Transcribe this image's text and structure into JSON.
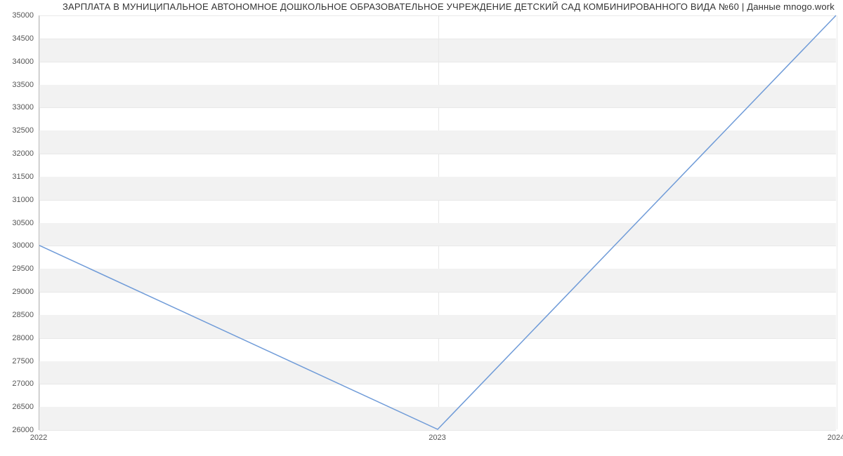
{
  "chart_data": {
    "type": "line",
    "title": "ЗАРПЛАТА В МУНИЦИПАЛЬНОЕ АВТОНОМНОЕ ДОШКОЛЬНОЕ ОБРАЗОВАТЕЛЬНОЕ УЧРЕЖДЕНИЕ ДЕТСКИЙ САД КОМБИНИРОВАННОГО ВИДА №60 | Данные mnogo.work",
    "x": [
      2022,
      2023,
      2024
    ],
    "values": [
      30000,
      26000,
      35000
    ],
    "xlabel": "",
    "ylabel": "",
    "xticks": [
      2022,
      2023,
      2024
    ],
    "yticks": [
      26000,
      26500,
      27000,
      27500,
      28000,
      28500,
      29000,
      29500,
      30000,
      30500,
      31000,
      31500,
      32000,
      32500,
      33000,
      33500,
      34000,
      34500,
      35000
    ],
    "ylim": [
      26000,
      35000
    ],
    "xlim": [
      2022,
      2024
    ],
    "grid": true,
    "line_color": "#6f9bd8"
  }
}
